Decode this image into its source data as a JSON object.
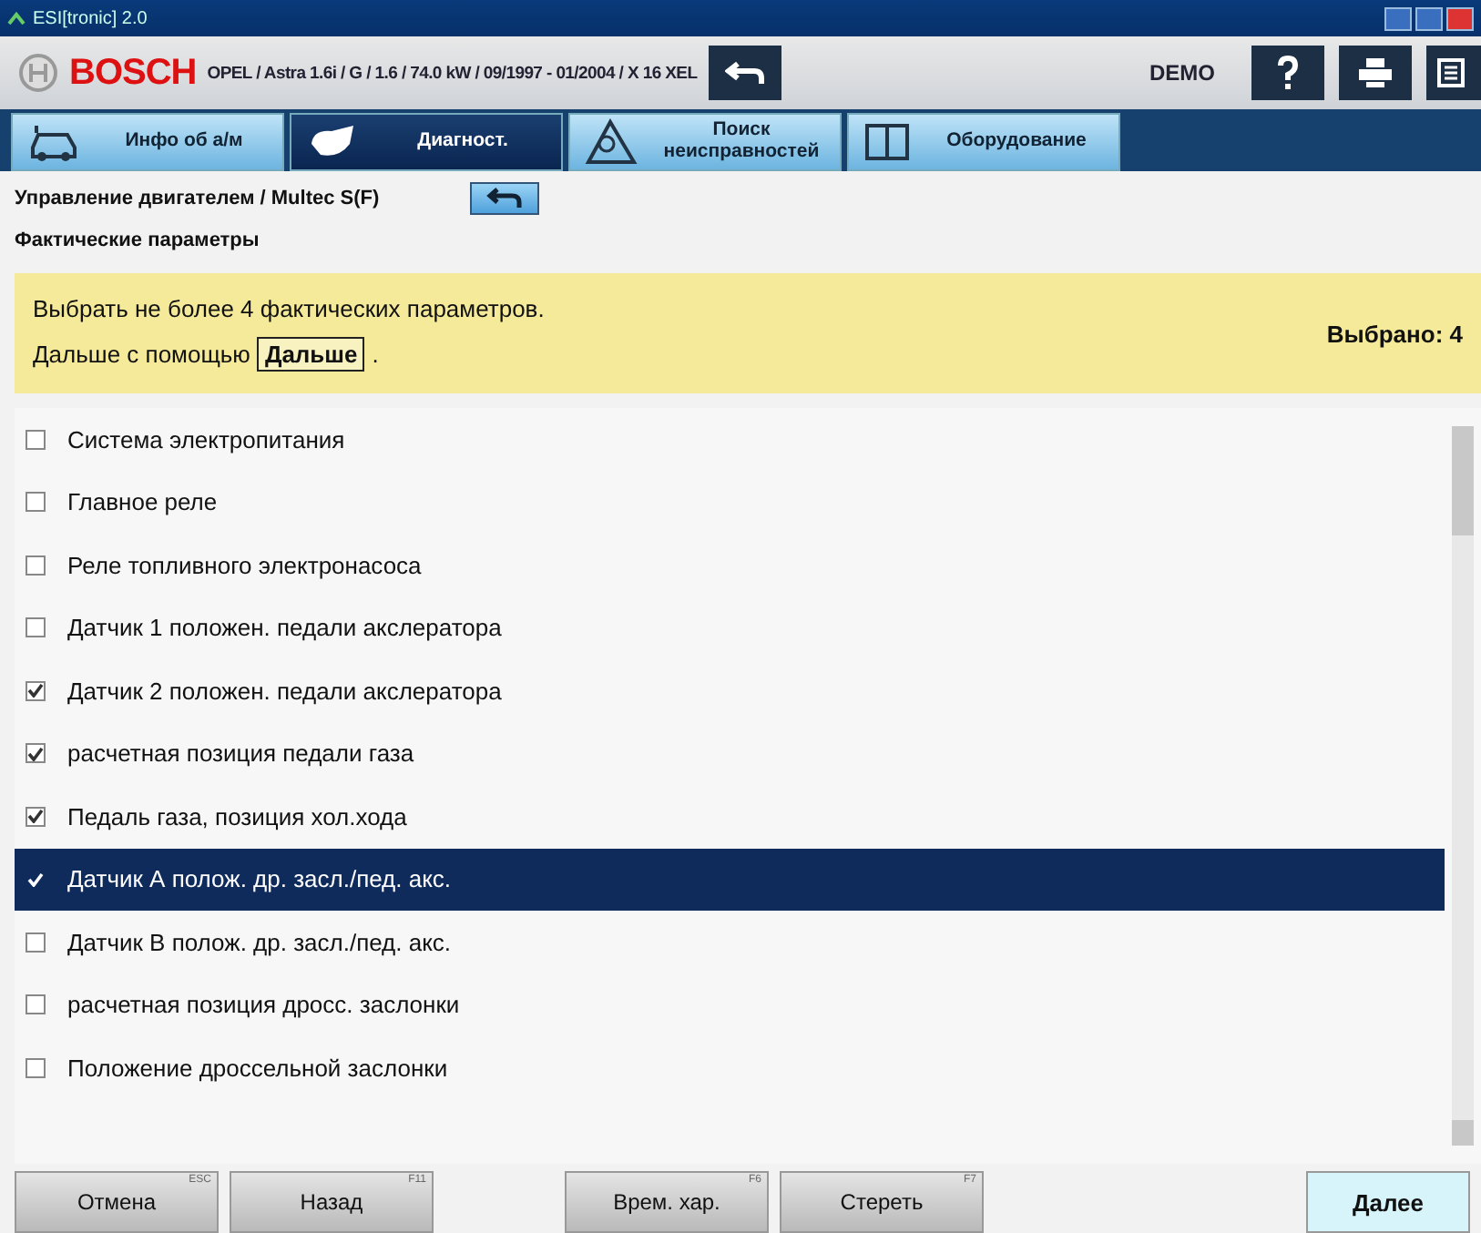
{
  "window": {
    "title": "ESI[tronic] 2.0"
  },
  "header": {
    "brand": "BOSCH",
    "vehicle": "OPEL / Astra 1.6i / G / 1.6 / 74.0 kW / 09/1997 - 01/2004 / X 16 XEL",
    "mode": "DEMO"
  },
  "tabs": [
    {
      "label": "Инфо об а/м",
      "kind": "vehicle",
      "selected": false
    },
    {
      "label": "Диагност.",
      "kind": "diagnosis",
      "selected": true
    },
    {
      "label": "Поиск неисправностей",
      "kind": "troubleshooting",
      "selected": false
    },
    {
      "label": "Оборудование",
      "kind": "equipment",
      "selected": false
    }
  ],
  "breadcrumb": {
    "path": "Управление двигателем / Multec S(F)",
    "subtitle": "Фактические параметры"
  },
  "notice": {
    "line1": "Выбрать не более 4 фактических параметров.",
    "line2_prefix": "Дальше с помощью",
    "line2_key": "Дальше",
    "line2_suffix": ".",
    "selected_count": "Выбрано: 4"
  },
  "parameters": [
    {
      "label": "Система электропитания",
      "checked": false,
      "selected": false
    },
    {
      "label": "Главное реле",
      "checked": false,
      "selected": false
    },
    {
      "label": "Реле топливного электронасоса",
      "checked": false,
      "selected": false
    },
    {
      "label": "Датчик 1 положен. педали акслератора",
      "checked": false,
      "selected": false
    },
    {
      "label": "Датчик 2 положен. педали акслератора",
      "checked": true,
      "selected": false
    },
    {
      "label": "расчетная позиция педали газа",
      "checked": true,
      "selected": false
    },
    {
      "label": "Педаль газа, позиция хол.хода",
      "checked": true,
      "selected": false
    },
    {
      "label": "Датчик А полож. др. засл./пед. акс.",
      "checked": true,
      "selected": true
    },
    {
      "label": "Датчик В полож. др. засл./пед. акс.",
      "checked": false,
      "selected": false
    },
    {
      "label": "расчетная позиция дросс. заслонки",
      "checked": false,
      "selected": false
    },
    {
      "label": "Положение дроссельной заслонки",
      "checked": false,
      "selected": false
    }
  ],
  "footer_buttons": [
    {
      "label": "Отмена",
      "key": "ESC",
      "kind": "grey"
    },
    {
      "label": "Назад",
      "key": "F11",
      "kind": "grey"
    },
    {
      "kind": "gap"
    },
    {
      "label": "Врем. хар.",
      "key": "F6",
      "kind": "grey"
    },
    {
      "label": "Стереть",
      "key": "F7",
      "kind": "grey"
    },
    {
      "kind": "gap"
    },
    {
      "label": "Далее",
      "kind": "primary"
    }
  ]
}
